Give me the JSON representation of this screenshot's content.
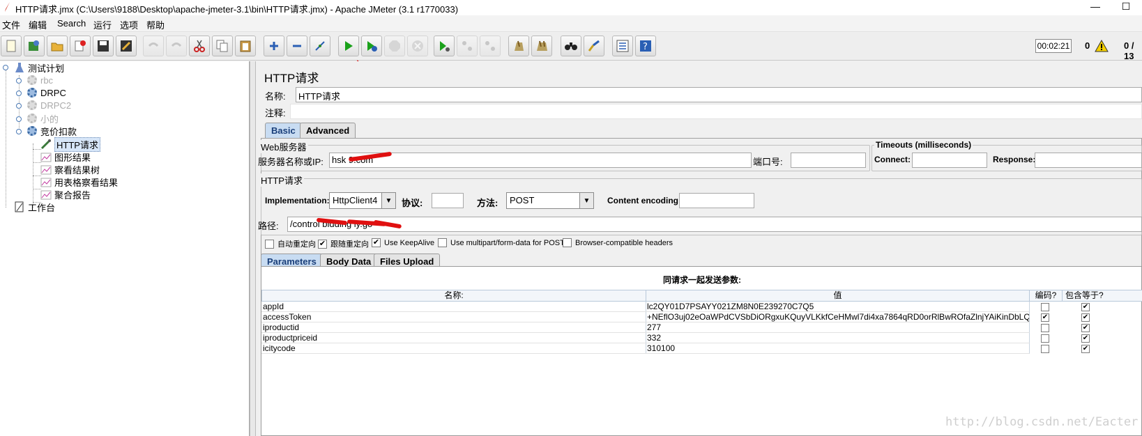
{
  "window": {
    "title": "HTTP请求.jmx (C:\\Users\\9188\\Desktop\\apache-jmeter-3.1\\bin\\HTTP请求.jmx) - Apache JMeter (3.1 r1770033)",
    "minimize": "—",
    "maximize": "☐"
  },
  "menu": [
    "文件",
    "编辑",
    "Search",
    "运行",
    "选项",
    "帮助"
  ],
  "toolbar": {
    "timer": "00:02:21",
    "error_count": "0",
    "threads": "0 / 13"
  },
  "tree": {
    "root": "测试计划",
    "items": [
      {
        "label": "rbc",
        "disabled": true
      },
      {
        "label": "DRPC",
        "disabled": false
      },
      {
        "label": "DRPC2",
        "disabled": true
      },
      {
        "label": "小的",
        "disabled": true
      },
      {
        "label": "竞价扣款",
        "disabled": false
      }
    ],
    "children": [
      {
        "label": "HTTP请求",
        "selected": true
      },
      {
        "label": "图形结果"
      },
      {
        "label": "察看结果树"
      },
      {
        "label": "用表格察看结果"
      },
      {
        "label": "聚合报告"
      }
    ],
    "workbench": "工作台"
  },
  "panel": {
    "title": "HTTP请求",
    "name_label": "名称:",
    "name_value": "HTTP请求",
    "comment_label": "注释:",
    "comment_value": "",
    "tabs": [
      "Basic",
      "Advanced"
    ],
    "web_server": {
      "title": "Web服务器",
      "server_label": "服务器名称或IP:",
      "server_value": "hsk           9.com",
      "port_label": "端口号:",
      "port_value": ""
    },
    "timeouts": {
      "title": "Timeouts (milliseconds)",
      "connect_label": "Connect:",
      "connect_value": "",
      "response_label": "Response:",
      "response_value": ""
    },
    "http_request": {
      "title": "HTTP请求",
      "impl_label": "Implementation:",
      "impl_value": "HttpClient4",
      "protocol_label": "协议:",
      "protocol_value": "",
      "method_label": "方法:",
      "method_value": "POST",
      "encoding_label": "Content encoding:",
      "encoding_value": "",
      "path_label": "路径:",
      "path_value": "/control          bidding         ly.go"
    },
    "options": [
      {
        "label": "自动重定向",
        "checked": false
      },
      {
        "label": "跟随重定向",
        "checked": true
      },
      {
        "label": "Use KeepAlive",
        "checked": true
      },
      {
        "label": "Use multipart/form-data for POST",
        "checked": false
      },
      {
        "label": "Browser-compatible headers",
        "checked": false
      }
    ],
    "subtabs": [
      "Parameters",
      "Body Data",
      "Files Upload"
    ],
    "params_caption": "同请求一起发送参数:",
    "columns": [
      "名称:",
      "值",
      "编码?",
      "包含等于?"
    ],
    "rows": [
      {
        "name": "appId",
        "value": "lc2QY01D7PSAYY021ZM8N0E239270C7Q5",
        "encode": false,
        "include_equals": true
      },
      {
        "name": "accessToken",
        "value": "+NEflO3uj02eOaWPdCVSbDiORgxuKQuyVLKkfCeHMwl7di4xa7864qRD0orRlBwROfaZlnjYAiKinDbLQ...",
        "encode": true,
        "include_equals": true
      },
      {
        "name": "iproductid",
        "value": "277",
        "encode": false,
        "include_equals": true
      },
      {
        "name": "iproductpriceid",
        "value": "332",
        "encode": false,
        "include_equals": true
      },
      {
        "name": "icitycode",
        "value": "310100",
        "encode": false,
        "include_equals": true
      }
    ]
  },
  "watermark": "http://blog.csdn.net/Eacter",
  "colors": {
    "accent_tab": "#c8dcf2",
    "arrow": "#e01010",
    "start_green": "#1aa11a"
  }
}
